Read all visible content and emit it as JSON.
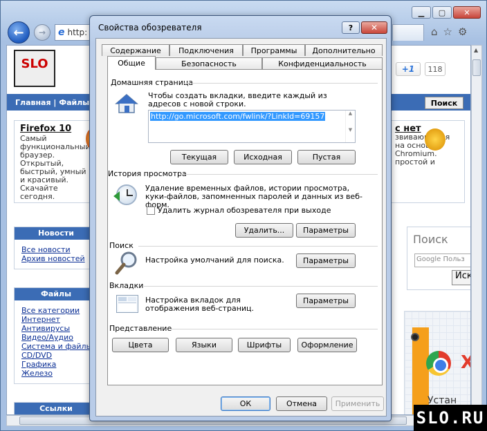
{
  "browser": {
    "address_text": "http:",
    "page": {
      "nav_text": "Главная | Файлы",
      "search_button": "Поиск",
      "gplus_label": "+1",
      "gplus_count": "118",
      "promo_left": {
        "title": "Firefox 10",
        "text": "Самый функциональный браузер. Открытый, быстрый, умный и красивый. Скачайте сегодня."
      },
      "promo_right": {
        "title_suffix": "с нет",
        "text": "звивающийся на основе Chromium. простой и"
      },
      "news_box": {
        "header": "Новости",
        "links": [
          "Все новости",
          "Архив новостей"
        ]
      },
      "files_box": {
        "header": "Файлы",
        "links": [
          "Все категории",
          "Интернет",
          "Антивирусы",
          "Видео/Аудио",
          "Система и файлы",
          "CD/DVD",
          "Графика",
          "Железо"
        ]
      },
      "links_box": {
        "header": "Ссылки"
      },
      "right_search": {
        "title": "Поиск",
        "input_placeholder": "Google Польз",
        "button": "Иск"
      },
      "ad": {
        "letter": "X",
        "text": "Устан"
      },
      "watermark": "SLO.RU"
    }
  },
  "dialog": {
    "title": "Свойства обозревателя",
    "help_label": "?",
    "close_label": "✕",
    "tabs_row1": [
      "Содержание",
      "Подключения",
      "Программы",
      "Дополнительно"
    ],
    "tabs_row2": [
      "Общие",
      "Безопасность",
      "Конфиденциальность"
    ],
    "home": {
      "label": "Домашняя страница",
      "description": "Чтобы создать вкладки, введите каждый из адресов с новой строки.",
      "url": "http://go.microsoft.com/fwlink/?LinkId=69157",
      "buttons": [
        "Текущая",
        "Исходная",
        "Пустая"
      ]
    },
    "history": {
      "label": "История просмотра",
      "description": "Удаление временных файлов, истории просмотра, куки-файлов, запомненных паролей и данных из веб-форм.",
      "checkbox_label": "Удалить журнал обозревателя при выходе",
      "checkbox_checked": false,
      "delete_button": "Удалить...",
      "settings_button": "Параметры"
    },
    "search": {
      "label": "Поиск",
      "description": "Настройка умолчаний для поиска.",
      "settings_button": "Параметры"
    },
    "tabs_group": {
      "label": "Вкладки",
      "description": "Настройка вкладок для отображения веб-страниц.",
      "settings_button": "Параметры"
    },
    "appearance": {
      "label": "Представление",
      "buttons": [
        "Цвета",
        "Языки",
        "Шрифты",
        "Оформление"
      ]
    },
    "footer": {
      "ok": "ОК",
      "cancel": "Отмена",
      "apply": "Применить"
    }
  }
}
